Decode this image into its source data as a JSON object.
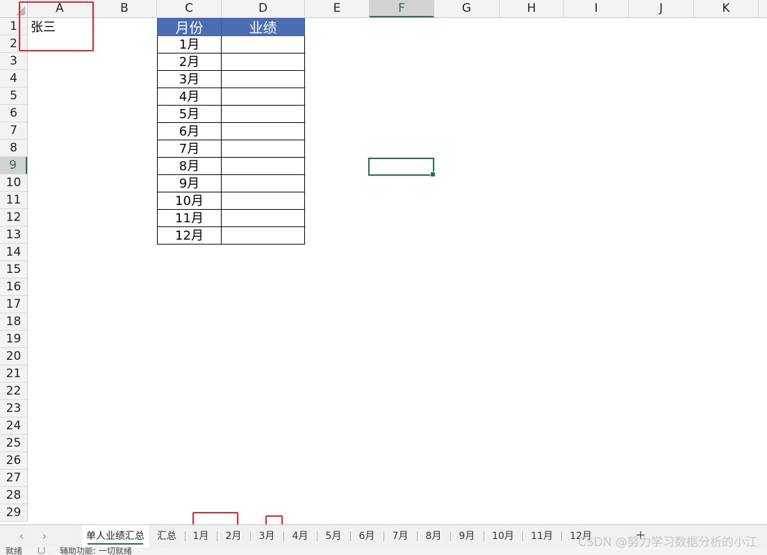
{
  "columns": [
    "A",
    "B",
    "C",
    "D",
    "E",
    "F",
    "G",
    "H",
    "I",
    "J",
    "K"
  ],
  "selected_column": "F",
  "rows": [
    "1",
    "2",
    "3",
    "4",
    "5",
    "6",
    "7",
    "8",
    "9",
    "10",
    "11",
    "12",
    "13",
    "14",
    "15",
    "16",
    "17",
    "18",
    "19",
    "20",
    "21",
    "22",
    "23",
    "24",
    "25",
    "26",
    "27",
    "28",
    "29"
  ],
  "selected_row": "9",
  "cell_a1": "张三",
  "table": {
    "header_month": "月份",
    "header_perf": "业绩",
    "months": [
      "1月",
      "2月",
      "3月",
      "4月",
      "5月",
      "6月",
      "7月",
      "8月",
      "9月",
      "10月",
      "11月",
      "12月"
    ],
    "header_color": "#4a6db5"
  },
  "sheet_tabs": [
    "单人业绩汇总",
    "汇总",
    "1月",
    "2月",
    "3月",
    "4月",
    "5月",
    "6月",
    "7月",
    "8月",
    "9月",
    "10月",
    "11月",
    "12月"
  ],
  "active_sheet": "单人业绩汇总",
  "add_sheet_label": "+",
  "nav": {
    "prev": "‹",
    "next": "›"
  },
  "status": {
    "ready": "就绪",
    "accessibility": "辅助功能: 一切就绪"
  },
  "watermark": "CSDN @努力学习数据分析的小江",
  "accent_color": "#217346",
  "highlight_color": "#e8252b"
}
